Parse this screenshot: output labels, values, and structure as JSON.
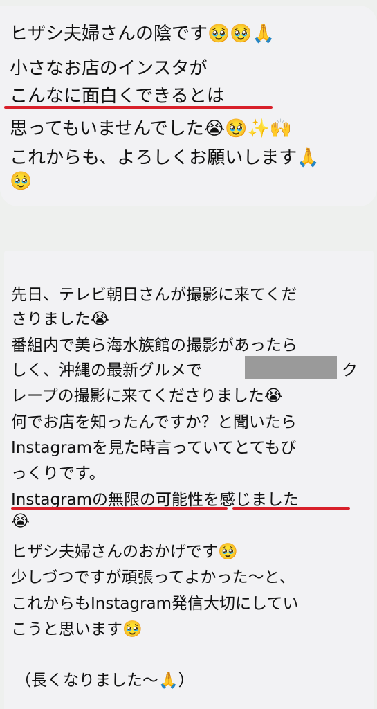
{
  "message1": {
    "lines": [
      "ヒザシ夫婦さんの陰です🥹🥹🙏",
      "小さなお店のインスタが",
      "こんなに面白くできるとは",
      "思ってもいませんでした😭🥹✨🙌",
      "これからも、よろしくお願いします🙏",
      "🥹"
    ]
  },
  "message2": {
    "lines": [
      "先日、テレビ朝日さんが撮影に来てくだ",
      "さりました😭",
      "番組内で美ら海水族館の撮影があったら",
      "しく、沖縄の最新グルメで",
      "ク",
      "レープの撮影に来てくださりました😭",
      "何でお店を知ったんですか？と聞いたら",
      "Instagramを見た時言っていてとてもび",
      "っくりです。",
      "Instagramの無限の可能性を感じました",
      "😭",
      "ヒザシ夫婦さんのおかげです🥹",
      "少しづつですが頑張ってよかった〜と、",
      "これからもInstagram発信大切にしてい",
      "こうと思います🥹",
      "（長くなりました〜🙏）"
    ]
  },
  "colors": {
    "background": "#eef0ee",
    "bubble": "#f2f2f4",
    "underline": "#d8202a",
    "redaction": "#9a9a9a"
  }
}
